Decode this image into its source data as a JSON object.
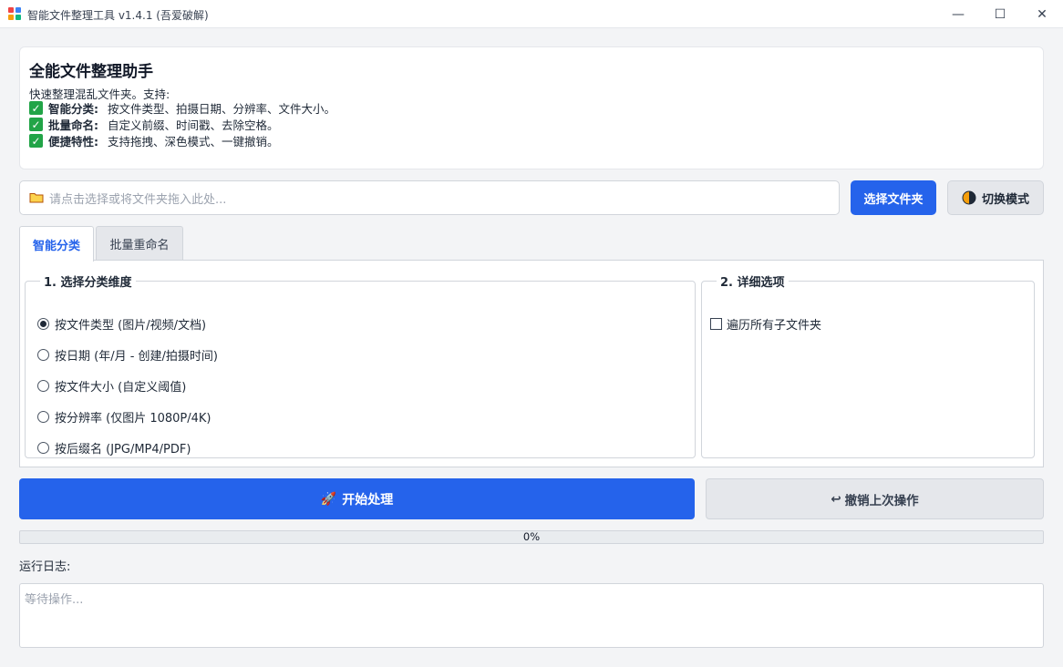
{
  "window": {
    "title": "智能文件整理工具 v1.4.1 (吾爱破解)",
    "minimize_glyph": "—",
    "maximize_glyph": "☐",
    "close_glyph": "✕"
  },
  "info": {
    "heading": "全能文件整理助手",
    "intro": "快速整理混乱文件夹。支持:",
    "features": [
      {
        "name": "智能分类:",
        "desc": "按文件类型、拍摄日期、分辨率、文件大小。"
      },
      {
        "name": "批量命名:",
        "desc": "自定义前缀、时间戳、去除空格。"
      },
      {
        "name": "便捷特性:",
        "desc": "支持拖拽、深色模式、一键撤销。"
      }
    ],
    "check_glyph": "✓"
  },
  "path": {
    "placeholder": "请点击选择或将文件夹拖入此处...",
    "folder_icon": "folder-icon"
  },
  "buttons": {
    "select_folder": "选择文件夹",
    "toggle_mode": "切换模式",
    "start": "开始处理",
    "start_icon": "🚀",
    "undo": "撤销上次操作",
    "undo_icon": "↩"
  },
  "tabs": [
    {
      "label": "智能分类",
      "active": true
    },
    {
      "label": "批量重命名",
      "active": false
    }
  ],
  "classify": {
    "group_title": "1. 选择分类维度",
    "options": [
      {
        "label": "按文件类型 (图片/视频/文档)",
        "selected": true
      },
      {
        "label": "按日期 (年/月 - 创建/拍摄时间)",
        "selected": false
      },
      {
        "label": "按文件大小 (自定义阈值)",
        "selected": false
      },
      {
        "label": "按分辨率 (仅图片 1080P/4K)",
        "selected": false
      },
      {
        "label": "按后缀名 (JPG/MP4/PDF)",
        "selected": false
      }
    ]
  },
  "details": {
    "group_title": "2. 详细选项",
    "recurse_label": "遍历所有子文件夹",
    "recurse_checked": false
  },
  "progress": {
    "value": 0,
    "text": "0%"
  },
  "log": {
    "label": "运行日志:",
    "content": "等待操作..."
  },
  "colors": {
    "accent": "#2563eb",
    "check_green": "#22a447",
    "background": "#f3f4f6"
  }
}
